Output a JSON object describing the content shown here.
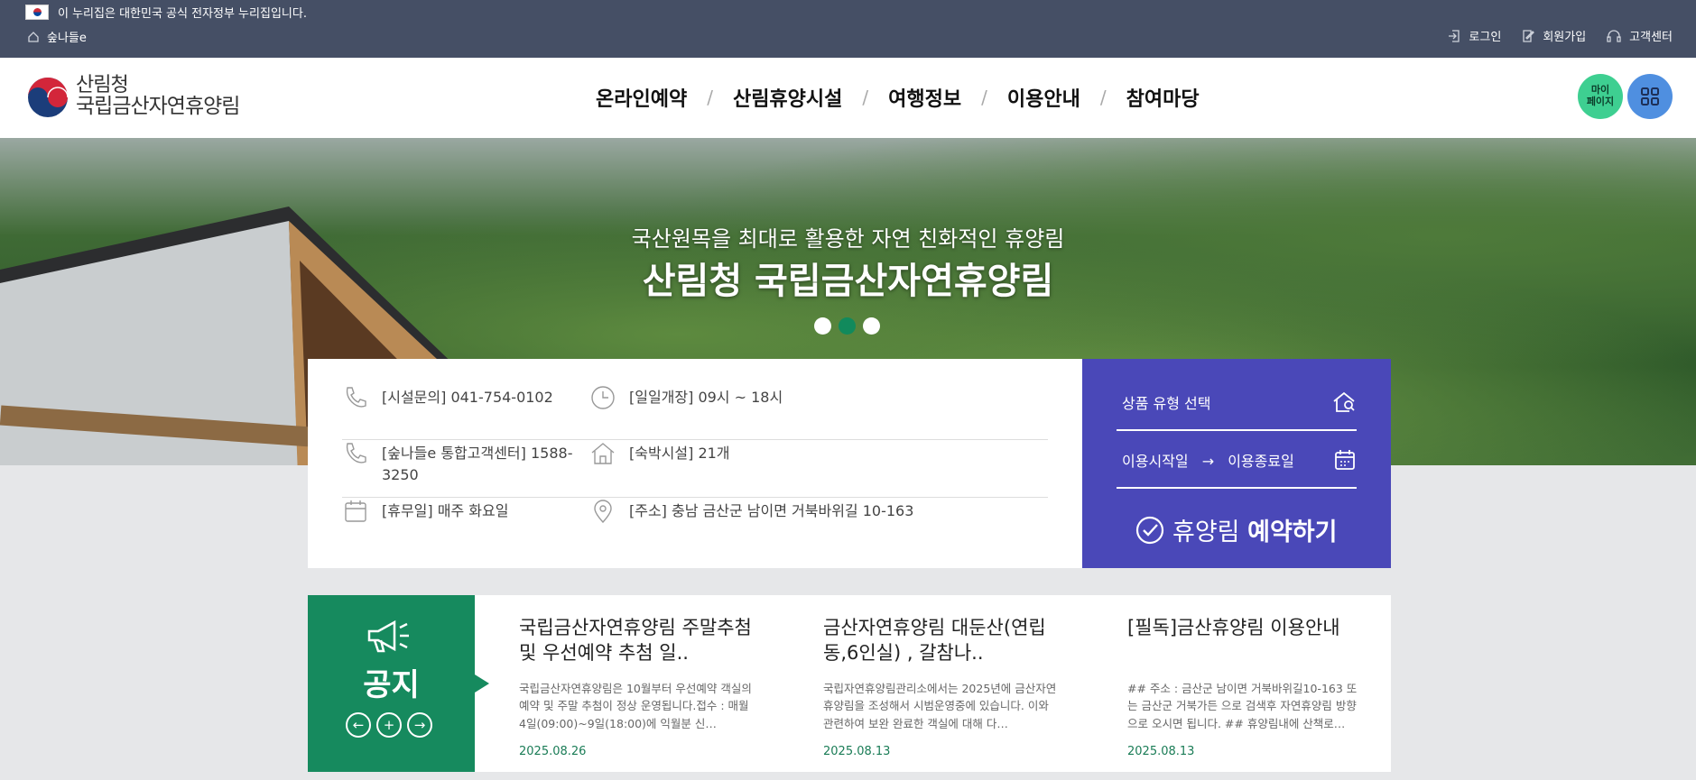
{
  "gov_banner": {
    "text": "이 누리집은 대한민국 공식 전자정부 누리집입니다."
  },
  "home_link": {
    "label": "숲나들e"
  },
  "util": [
    {
      "label": "로그인",
      "icon": "login-icon"
    },
    {
      "label": "회원가입",
      "icon": "signup-icon"
    },
    {
      "label": "고객센터",
      "icon": "headset-icon"
    }
  ],
  "logo": {
    "line1": "산림청",
    "line2": "국립금산자연휴양림"
  },
  "gnb": [
    "온라인예약",
    "산림휴양시설",
    "여행정보",
    "이용안내",
    "참여마당"
  ],
  "gnb_sep": "/",
  "mypage": {
    "label_1": "마이",
    "label_2": "페이지"
  },
  "hero": {
    "subtitle": "국산원목을 최대로 활용한 자연 친화적인 휴양림",
    "title": "산림청 국립금산자연휴양림",
    "slides": 3,
    "active_slide": 2
  },
  "info": {
    "phone": "[시설문의] 041-754-0102",
    "hours": "[일일개장] 09시 ~ 18시",
    "center": "[숲나들e 통합고객센터] 1588-3250",
    "lodging": "[숙박시설] 21개",
    "closed": "[휴무일] 매주 화요일",
    "address": "[주소] 충남 금산군 남이면 거북바위길 10-163"
  },
  "reserve": {
    "product_placeholder": "상품 유형 선택",
    "start_label": "이용시작일",
    "arrow": "→",
    "end_label": "이용종료일",
    "btn_light": "휴양림",
    "btn_bold": "예약하기"
  },
  "notice": {
    "title": "공지",
    "ctrl_prev": "←",
    "ctrl_plus": "+",
    "ctrl_next": "→",
    "posts": [
      {
        "title": "국립금산자연휴양림 주말추첨 및 우선예약 추첨 일..",
        "desc": "국립금산자연휴양림은 10월부터 우선예약 객실의 예약 및 주말 추첨이 정상 운영됩니다.접수 : 매월 4일(09:00)~9일(18:00)에 익월분 신…",
        "date": "2025.08.26"
      },
      {
        "title": "금산자연휴양림 대둔산(연립동,6인실) , 갈참나..",
        "desc": "국립자연휴양림관리소에서는 2025년에 금산자연휴양림을 조성해서 시범운영중에 있습니다. 이와 관련하여 보완 완료한 객실에 대해 다…",
        "date": "2025.08.13"
      },
      {
        "title": "[필독]금산휴양림 이용안내",
        "desc": "## 주소 : 금산군 남이면 거북바위길10-163 또는 금산군 거북가든 으로 검색후 자연휴양림 방향으로 오시면 됩니다. ## 휴양림내에 산책로…",
        "date": "2025.08.13"
      }
    ]
  },
  "colors": {
    "topbar": "#454f65",
    "reserve": "#4a48b8",
    "notice": "#168a5e",
    "accent_dot": "#118a5c"
  }
}
